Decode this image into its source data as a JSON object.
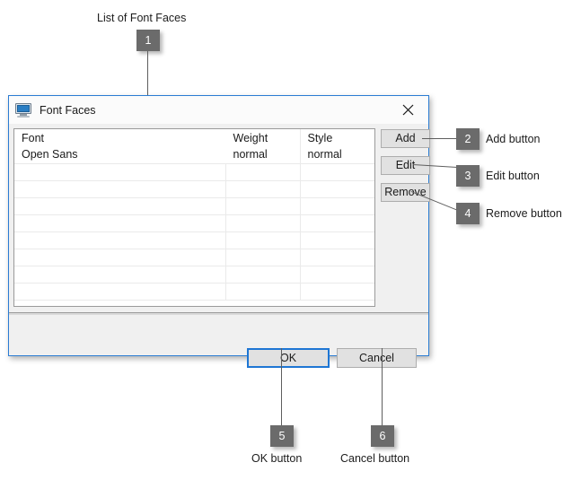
{
  "dialog": {
    "title": "Font Faces",
    "title_icon": "monitor-icon",
    "close_icon": "close-icon",
    "accent_color": "#1e76d4",
    "table": {
      "columns": [
        "Font",
        "Weight",
        "Style"
      ],
      "rows": [
        {
          "font": "Open Sans",
          "weight": "normal",
          "style": "normal"
        }
      ],
      "empty_row_count": 8
    },
    "side_buttons": {
      "add": "Add",
      "edit": "Edit",
      "remove": "Remove"
    },
    "footer_buttons": {
      "ok": "OK",
      "cancel": "Cancel"
    }
  },
  "annotations": {
    "list_title": "List of Font Faces",
    "items": [
      {
        "number": "1",
        "label": ""
      },
      {
        "number": "2",
        "label": "Add button"
      },
      {
        "number": "3",
        "label": "Edit button"
      },
      {
        "number": "4",
        "label": "Remove button"
      },
      {
        "number": "5",
        "label": "OK button"
      },
      {
        "number": "6",
        "label": "Cancel button"
      }
    ]
  }
}
